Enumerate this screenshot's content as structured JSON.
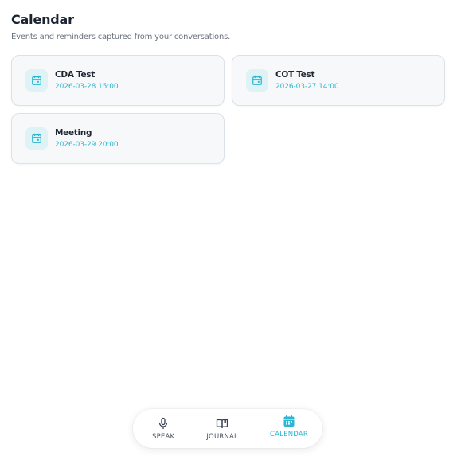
{
  "header": {
    "title": "Calendar",
    "subtitle": "Events and reminders captured from your conversations."
  },
  "events": [
    {
      "title": "CDA Test",
      "datetime": "2026-03-28 15:00",
      "icon": "calendar-event-icon"
    },
    {
      "title": "COT Test",
      "datetime": "2026-03-27 14:00",
      "icon": "calendar-event-icon"
    },
    {
      "title": "Meeting",
      "datetime": "2026-03-29 20:00",
      "icon": "calendar-event-icon"
    }
  ],
  "nav": {
    "items": [
      {
        "label": "SPEAK",
        "icon": "microphone-icon",
        "active": false
      },
      {
        "label": "JOURNAL",
        "icon": "book-icon",
        "active": false
      },
      {
        "label": "CALENDAR",
        "icon": "calendar-icon",
        "active": true
      }
    ]
  },
  "colors": {
    "accent": "#2bb6d2",
    "title": "#1b2431",
    "muted": "#6b7380",
    "card_bg": "#f7f8fa",
    "icon_bg": "#dff2f6"
  }
}
